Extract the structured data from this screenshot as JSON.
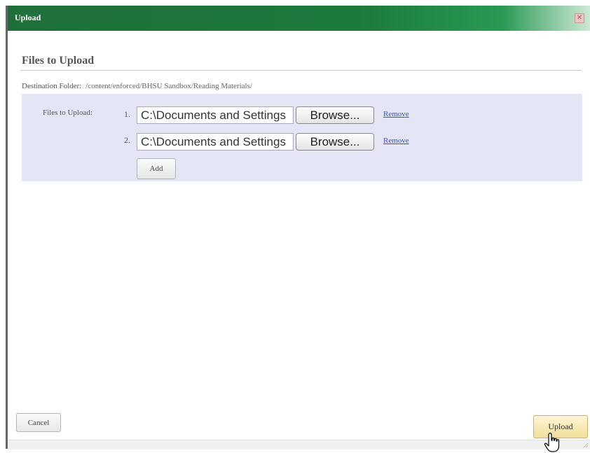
{
  "dialog": {
    "title": "Upload",
    "close_icon": "close-icon"
  },
  "section": {
    "title": "Files to Upload"
  },
  "destination": {
    "label": "Destination Folder:",
    "value": "/content/enforced/BHSU Sandbox/Reading Materials/"
  },
  "files": {
    "label": "Files to Upload:",
    "rows": [
      {
        "num": "1.",
        "path": "C:\\Documents and Settings",
        "browse": "Browse...",
        "remove": "Remove"
      },
      {
        "num": "2.",
        "path": "C:\\Documents and Settings",
        "browse": "Browse...",
        "remove": "Remove"
      }
    ],
    "add_label": "Add"
  },
  "footer": {
    "cancel_label": "Cancel",
    "upload_label": "Upload"
  },
  "colors": {
    "titlebar": "#1f6f3a",
    "panel": "#e5e6f5",
    "link": "#3b53c8",
    "upload_button": "#f2df9a"
  }
}
